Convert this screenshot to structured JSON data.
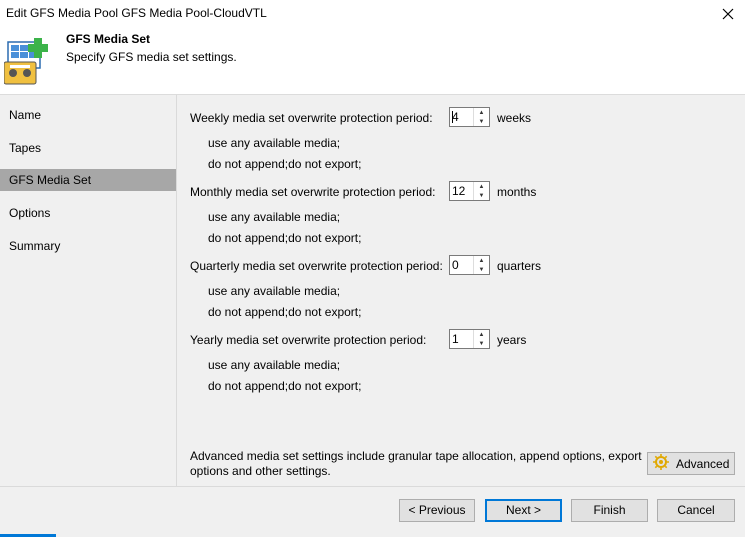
{
  "window": {
    "title": "Edit GFS Media Pool GFS Media Pool-CloudVTL"
  },
  "header": {
    "title": "GFS Media Set",
    "subtitle": "Specify GFS media set settings."
  },
  "sidebar": {
    "items": [
      {
        "label": "Name"
      },
      {
        "label": "Tapes"
      },
      {
        "label": "GFS Media Set"
      },
      {
        "label": "Options"
      },
      {
        "label": "Summary"
      }
    ]
  },
  "periods": [
    {
      "label": "Weekly media set overwrite protection period:",
      "value": "4",
      "unit": "weeks",
      "line1": "use any available media;",
      "line2": "do not append;do not export;"
    },
    {
      "label": "Monthly media set overwrite protection period:",
      "value": "12",
      "unit": "months",
      "line1": "use any available media;",
      "line2": "do not append;do not export;"
    },
    {
      "label": "Quarterly media set overwrite protection period:",
      "value": "0",
      "unit": "quarters",
      "line1": "use any available media;",
      "line2": "do not append;do not export;"
    },
    {
      "label": "Yearly media set overwrite protection period:",
      "value": "1",
      "unit": "years",
      "line1": "use any available media;",
      "line2": "do not append;do not export;"
    }
  ],
  "advanced": {
    "note_line1": "Advanced media set settings include granular tape allocation, append options, export",
    "note_line2": "options and other settings.",
    "button_label": "Advanced"
  },
  "footer": {
    "previous": "< Previous",
    "next": "Next >",
    "finish": "Finish",
    "cancel": "Cancel"
  },
  "colors": {
    "accent": "#0078d7",
    "selected_item": "#a7a7a7",
    "panel": "#f0f0f0"
  }
}
